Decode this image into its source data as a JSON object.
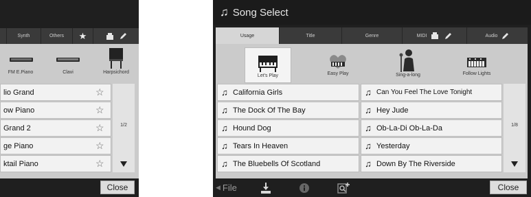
{
  "left_panel": {
    "tabs": [
      {
        "label": "Synth"
      },
      {
        "label": "Others"
      }
    ],
    "categories": [
      {
        "label": "FM E.Piano",
        "icon": "keyboard-icon"
      },
      {
        "label": "Clavi",
        "icon": "keyboard-icon"
      },
      {
        "label": "Harpsichord",
        "icon": "harpsichord-icon"
      }
    ],
    "voices": [
      {
        "label": "lio Grand"
      },
      {
        "label": "ow Piano"
      },
      {
        "label": "Grand 2"
      },
      {
        "label": "ge Piano"
      },
      {
        "label": "ktail Piano"
      }
    ],
    "page": "1/2",
    "close_label": "Close"
  },
  "song_select": {
    "title": "Song Select",
    "tabs": [
      {
        "label": "Usage",
        "active": true
      },
      {
        "label": "Title"
      },
      {
        "label": "Genre"
      },
      {
        "label": "MIDI"
      },
      {
        "label": "Audio"
      }
    ],
    "categories": [
      {
        "label": "Let's Play",
        "icon": "piano-icon",
        "selected": true
      },
      {
        "label": "Easy Play",
        "icon": "heart-keyboard-icon"
      },
      {
        "label": "Sing-a-long",
        "icon": "singer-icon"
      },
      {
        "label": "Follow Lights",
        "icon": "keyboard-lights-icon"
      }
    ],
    "songs_left": [
      {
        "title": "California Girls"
      },
      {
        "title": "The Dock Of The Bay"
      },
      {
        "title": "Hound Dog"
      },
      {
        "title": "Tears In Heaven"
      },
      {
        "title": "The Bluebells Of Scotland"
      }
    ],
    "songs_right": [
      {
        "title": "Can You Feel The Love Tonight"
      },
      {
        "title": "Hey Jude"
      },
      {
        "title": "Ob-La-Di Ob-La-Da"
      },
      {
        "title": "Yesterday"
      },
      {
        "title": "Down By The Riverside"
      }
    ],
    "page": "1/8",
    "bottom": {
      "file_label": "File",
      "close_label": "Close"
    }
  }
}
